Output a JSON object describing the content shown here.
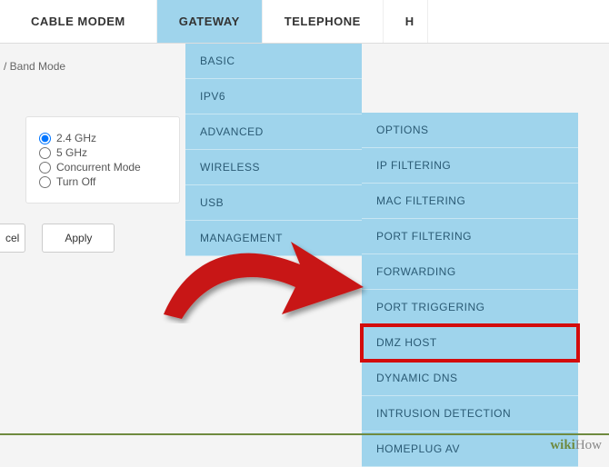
{
  "topnav": {
    "items": [
      {
        "label": "CABLE MODEM",
        "active": false
      },
      {
        "label": "GATEWAY",
        "active": true
      },
      {
        "label": "TELEPHONE",
        "active": false
      },
      {
        "label": "H",
        "active": false
      }
    ]
  },
  "breadcrumb": "/ Band Mode",
  "band_modes": {
    "options": [
      {
        "label": "2.4 GHz",
        "checked": true
      },
      {
        "label": "5 GHz",
        "checked": false
      },
      {
        "label": "Concurrent Mode",
        "checked": false
      },
      {
        "label": "Turn Off",
        "checked": false
      }
    ]
  },
  "buttons": {
    "cancel": "cel",
    "apply": "Apply"
  },
  "menu1": {
    "items": [
      "BASIC",
      "IPV6",
      "ADVANCED",
      "WIRELESS",
      "USB",
      "MANAGEMENT"
    ]
  },
  "menu2": {
    "items": [
      "OPTIONS",
      "IP FILTERING",
      "MAC FILTERING",
      "PORT FILTERING",
      "FORWARDING",
      "PORT TRIGGERING",
      "DMZ HOST",
      "DYNAMIC DNS",
      "INTRUSION DETECTION",
      "HOMEPLUG AV"
    ],
    "highlight_index": 6
  },
  "watermark": {
    "prefix": "wiki",
    "suffix": "How"
  }
}
